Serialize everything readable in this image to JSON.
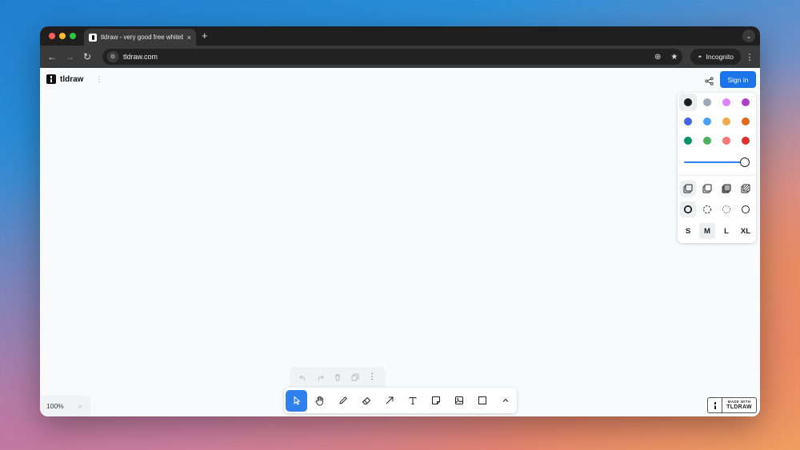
{
  "browser": {
    "tab_title": "tldraw - very good free whiteboard",
    "url": "tldraw.com",
    "incognito_label": "Incognito",
    "new_tab_label": "+",
    "close_tab_label": "×"
  },
  "app": {
    "brand_name": "tldraw",
    "signin_label": "Sign in",
    "zoom_level": "100%",
    "made_with_top": "MADE WITH",
    "made_with_bottom": "TLDRAW"
  },
  "style_panel": {
    "colors": [
      {
        "name": "black",
        "hex": "#1d1d1d",
        "selected": true
      },
      {
        "name": "grey",
        "hex": "#9fa8b2"
      },
      {
        "name": "light-violet",
        "hex": "#e085f4"
      },
      {
        "name": "violet",
        "hex": "#ae3ec9"
      },
      {
        "name": "blue",
        "hex": "#4465e9"
      },
      {
        "name": "light-blue",
        "hex": "#4ba1f1"
      },
      {
        "name": "yellow",
        "hex": "#f1ac4b"
      },
      {
        "name": "orange",
        "hex": "#e16919"
      },
      {
        "name": "green",
        "hex": "#099268"
      },
      {
        "name": "light-green",
        "hex": "#4cb05e"
      },
      {
        "name": "light-red",
        "hex": "#f87777"
      },
      {
        "name": "red",
        "hex": "#e03131"
      }
    ],
    "opacity": 1,
    "fill_options": [
      "none",
      "semi",
      "solid",
      "pattern"
    ],
    "dash_options": [
      "draw",
      "dashed",
      "dotted",
      "solid"
    ],
    "sizes": [
      "S",
      "M",
      "L",
      "XL"
    ],
    "selected_size": "M",
    "accent": "#2f80ed"
  },
  "toolbar": {
    "tools": [
      "select",
      "hand",
      "draw",
      "eraser",
      "arrow",
      "text",
      "note",
      "media",
      "rectangle",
      "more"
    ],
    "active_tool": "select"
  }
}
